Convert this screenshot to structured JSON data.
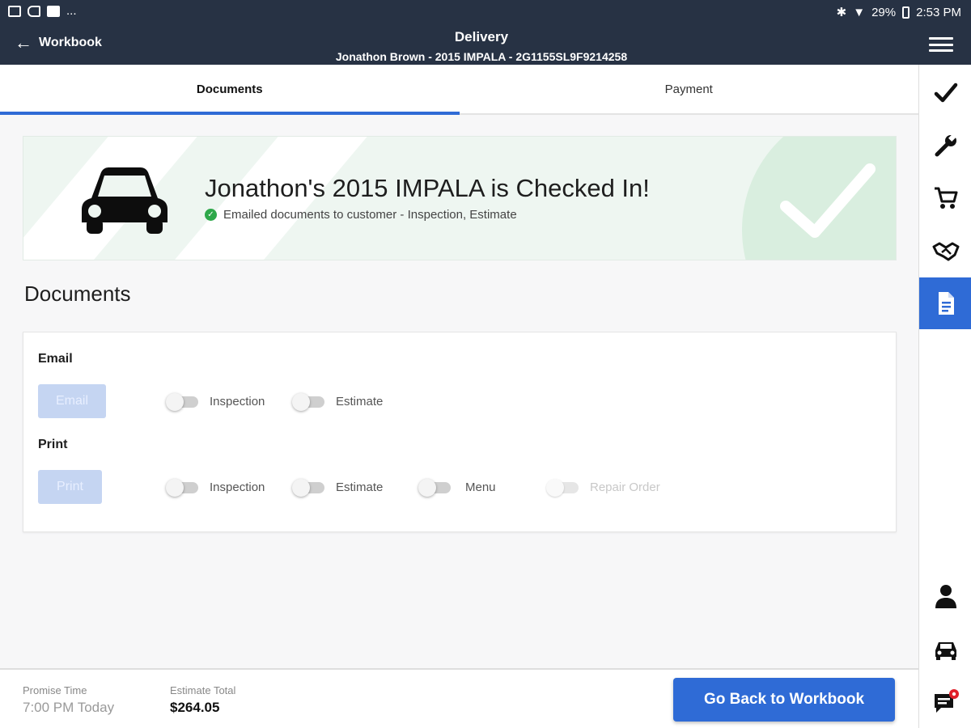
{
  "status_bar": {
    "left_icons": [
      "image-icon",
      "cast-icon",
      "flipboard-icon"
    ],
    "overflow": "...",
    "battery": "29%",
    "time": "2:53 PM"
  },
  "header": {
    "back_label": "Workbook",
    "title": "Delivery",
    "subtitle": "Jonathon Brown - 2015 IMPALA - 2G1155SL9F9214258"
  },
  "tabs": [
    {
      "label": "Documents",
      "active": true
    },
    {
      "label": "Payment",
      "active": false
    }
  ],
  "banner": {
    "title": "Jonathon's 2015 IMPALA is Checked In!",
    "subtitle": "Emailed documents to customer - Inspection, Estimate"
  },
  "documents": {
    "title": "Documents",
    "email": {
      "label": "Email",
      "button": "Email",
      "toggles": [
        "Inspection",
        "Estimate"
      ]
    },
    "print": {
      "label": "Print",
      "button": "Print",
      "toggles": [
        "Inspection",
        "Estimate",
        "Menu",
        "Repair Order"
      ]
    }
  },
  "footer": {
    "promise_label": "Promise Time",
    "promise_value": "7:00 PM Today",
    "estimate_label": "Estimate Total",
    "estimate_value": "$264.05",
    "cta": "Go Back to Workbook"
  },
  "sidebar": {
    "items": [
      "check-icon",
      "wrench-icon",
      "cart-icon",
      "handshake-icon",
      "document-icon",
      "person-icon",
      "car-icon",
      "chat-icon"
    ],
    "active": "document-icon",
    "accent": "#2f6bd6"
  },
  "colors": {
    "header_bg": "#273244",
    "accent": "#2f6bd6",
    "banner_bg": "#eef6f1",
    "success": "#2ea84a",
    "notification": "#e0202a"
  }
}
